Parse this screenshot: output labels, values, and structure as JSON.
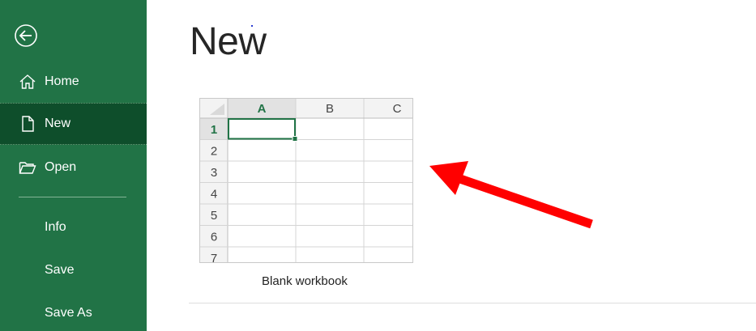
{
  "sidebar": {
    "back_icon": "back-arrow-circle-icon",
    "items": [
      {
        "label": "Home",
        "icon": "home-icon",
        "selected": false
      },
      {
        "label": "New",
        "icon": "new-document-icon",
        "selected": true
      },
      {
        "label": "Open",
        "icon": "folder-open-icon",
        "selected": false
      },
      {
        "label": "Info",
        "icon": "",
        "selected": false
      },
      {
        "label": "Save",
        "icon": "",
        "selected": false
      },
      {
        "label": "Save As",
        "icon": "",
        "selected": false
      }
    ]
  },
  "main": {
    "title": "New",
    "templates": [
      {
        "label": "Blank workbook",
        "columns": [
          "A",
          "B",
          "C"
        ],
        "rows": [
          "1",
          "2",
          "3",
          "4",
          "5",
          "6",
          "7"
        ],
        "active_cell": "A1"
      }
    ]
  },
  "annotation": {
    "arrow_color": "#ff0000",
    "points_to": "Blank workbook"
  },
  "colors": {
    "sidebar_bg": "#217346",
    "sidebar_selected": "#0e4e2b",
    "accent_green": "#217346",
    "header_bg": "#f3f3f3",
    "header_selected": "#e2e2e2",
    "grid_line": "#d4d4d4"
  }
}
